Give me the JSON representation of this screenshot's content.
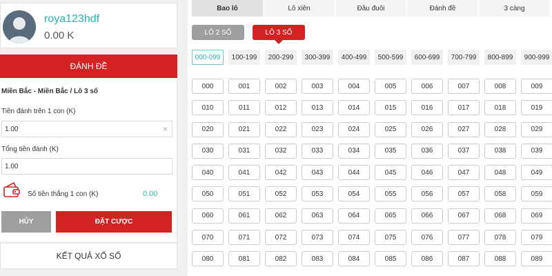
{
  "user": {
    "username": "roya123hdf",
    "balance": "0.00 K",
    "avatar_icon": "user-avatar-icon"
  },
  "left": {
    "danh_de_label": "ĐÁNH ĐỀ",
    "region": "Miền Bắc - Miền Bắc / Lô 3 số",
    "stake_label": "Tiền đánh trên 1 con (K)",
    "stake_value": "1.00",
    "clear_icon": "×",
    "total_label": "Tổng tiền đánh (K)",
    "total_value": "1.00",
    "win_label": "Số tiền thắng 1 con (K)",
    "win_value": "0.00",
    "cancel_label": "HỦY",
    "bet_label": "ĐẶT CƯỢC",
    "results_label": "KẾT QUẢ XỔ SỐ"
  },
  "tabs": [
    "Bao lô",
    "Lô xiên",
    "Đầu đuôi",
    "Đánh đề",
    "3 càng"
  ],
  "lo_buttons": [
    "LÔ 2 SỐ",
    "LÔ 3 SỐ"
  ],
  "ranges": [
    "000-099",
    "100-199",
    "200-299",
    "300-399",
    "400-499",
    "500-599",
    "600-699",
    "700-799",
    "800-899",
    "900-999"
  ],
  "numbers": [
    "000",
    "001",
    "002",
    "003",
    "004",
    "005",
    "006",
    "007",
    "008",
    "009",
    "010",
    "011",
    "012",
    "013",
    "014",
    "015",
    "016",
    "017",
    "018",
    "019",
    "020",
    "021",
    "022",
    "023",
    "024",
    "025",
    "026",
    "027",
    "028",
    "029",
    "030",
    "031",
    "032",
    "033",
    "034",
    "035",
    "036",
    "037",
    "038",
    "039",
    "040",
    "041",
    "042",
    "043",
    "044",
    "045",
    "046",
    "047",
    "048",
    "049",
    "050",
    "051",
    "052",
    "053",
    "054",
    "055",
    "056",
    "057",
    "058",
    "059",
    "060",
    "061",
    "062",
    "063",
    "064",
    "065",
    "066",
    "067",
    "068",
    "069",
    "070",
    "071",
    "072",
    "073",
    "074",
    "075",
    "076",
    "077",
    "078",
    "079",
    "080",
    "081",
    "082",
    "083",
    "084",
    "085",
    "086",
    "087",
    "088",
    "089"
  ],
  "colors": {
    "accent_red": "#d32222",
    "accent_teal": "#2aaeb0",
    "gray_button": "#9e9e9e"
  }
}
